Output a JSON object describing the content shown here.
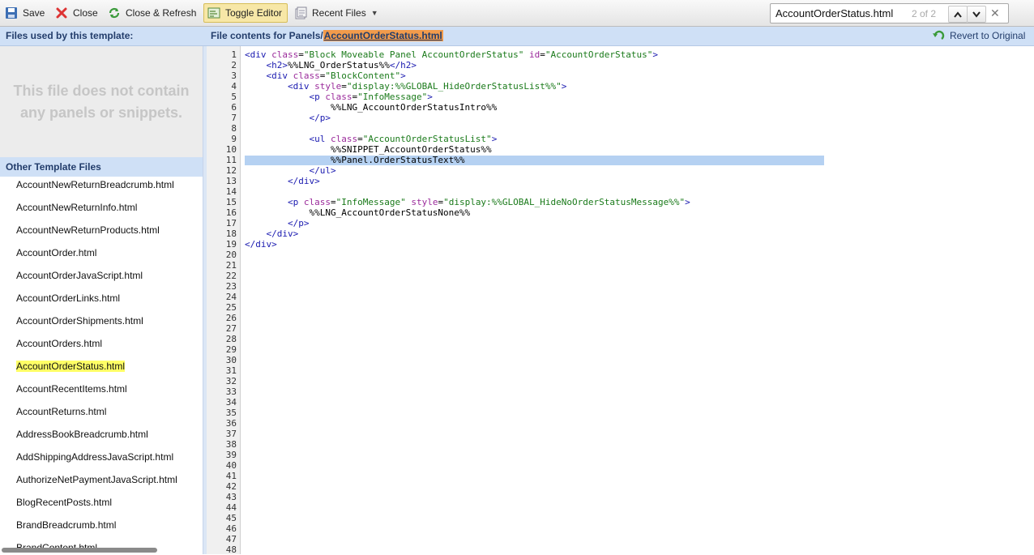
{
  "toolbar": {
    "save": "Save",
    "close": "Close",
    "close_refresh": "Close & Refresh",
    "toggle_editor": "Toggle Editor",
    "recent_files": "Recent Files"
  },
  "search": {
    "value": "AccountOrderStatus.html",
    "count": "2 of 2"
  },
  "header": {
    "left_title": "Files used by this template:",
    "mid_prefix": "File contents for Panels/",
    "mid_file": "AccountOrderStatus.html",
    "revert": "Revert to Original"
  },
  "left": {
    "empty_line1": "This file does not contain",
    "empty_line2": "any panels or snippets.",
    "other_title": "Other Template Files",
    "files": [
      "AccountNewReturnBreadcrumb.html",
      "AccountNewReturnInfo.html",
      "AccountNewReturnProducts.html",
      "AccountOrder.html",
      "AccountOrderJavaScript.html",
      "AccountOrderLinks.html",
      "AccountOrderShipments.html",
      "AccountOrders.html",
      "AccountOrderStatus.html",
      "AccountRecentItems.html",
      "AccountReturns.html",
      "AddressBookBreadcrumb.html",
      "AddShippingAddressJavaScript.html",
      "AuthorizeNetPaymentJavaScript.html",
      "BlogRecentPosts.html",
      "BrandBreadcrumb.html",
      "BrandContent.html"
    ],
    "selected_index": 8
  },
  "editor": {
    "line_count": 48,
    "highlight_line": 11,
    "lines": [
      "<div class=\"Block Moveable Panel AccountOrderStatus\" id=\"AccountOrderStatus\">",
      "    <h2>%%LNG_OrderStatus%%</h2>",
      "    <div class=\"BlockContent\">",
      "        <div style=\"display:%%GLOBAL_HideOrderStatusList%%\">",
      "            <p class=\"InfoMessage\">",
      "                %%LNG_AccountOrderStatusIntro%%",
      "            </p>",
      "",
      "            <ul class=\"AccountOrderStatusList\">",
      "                %%SNIPPET_AccountOrderStatus%%",
      "                %%Panel.OrderStatusText%%",
      "            </ul>",
      "        </div>",
      "",
      "        <p class=\"InfoMessage\" style=\"display:%%GLOBAL_HideNoOrderStatusMessage%%\">",
      "            %%LNG_AccountOrderStatusNone%%",
      "        </p>",
      "    </div>",
      "</div>"
    ]
  }
}
